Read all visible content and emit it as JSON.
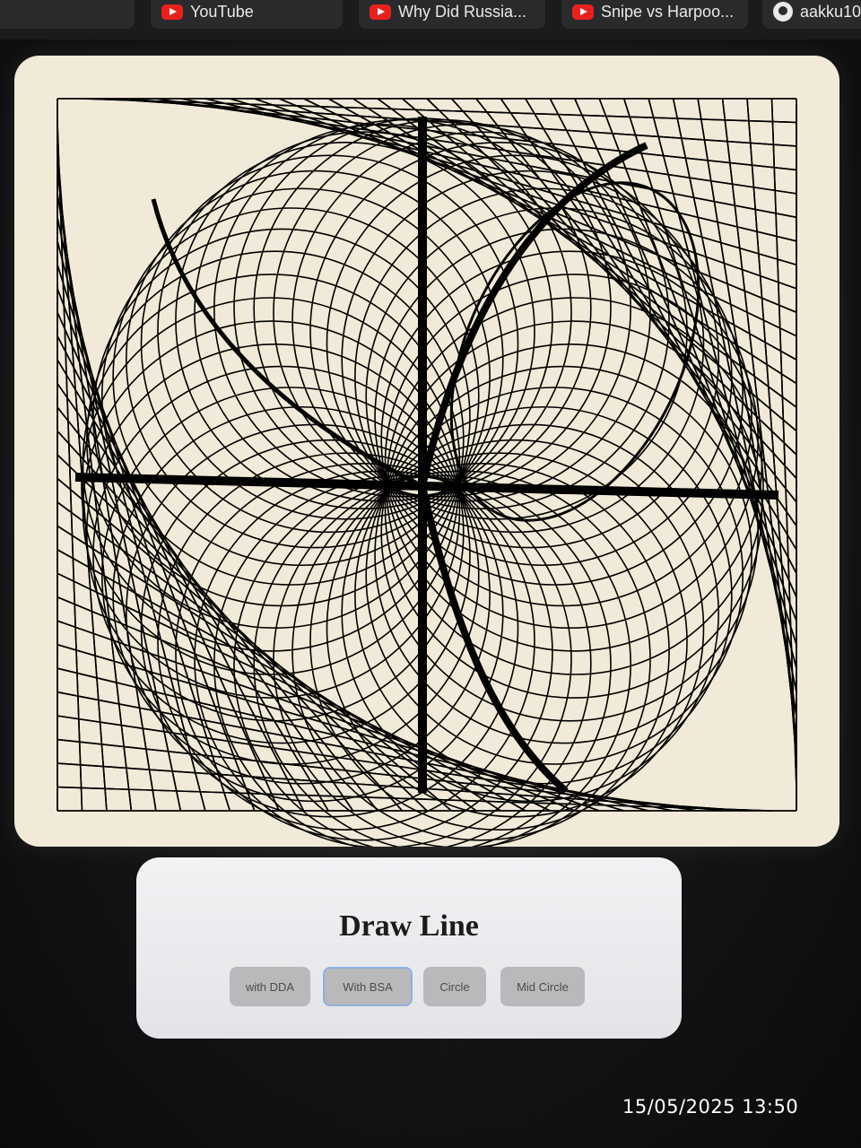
{
  "bookmarks": [
    {
      "label": "",
      "icon": "blank"
    },
    {
      "label": "YouTube",
      "icon": "youtube-icon"
    },
    {
      "label": "Why Did Russia...",
      "icon": "youtube-icon"
    },
    {
      "label": "Snipe vs Harpoo...",
      "icon": "youtube-icon"
    },
    {
      "label": "aakku10",
      "icon": "github-icon"
    }
  ],
  "panel": {
    "title": "Draw Line",
    "buttons": [
      {
        "label": "with DDA"
      },
      {
        "label": "With BSA",
        "active": true
      },
      {
        "label": "Circle"
      },
      {
        "label": "Mid Circle"
      }
    ]
  },
  "timestamp": "15/05/2025  13:50",
  "colors": {
    "canvas_bg": "#f1ead8",
    "ink": "#000000",
    "panel_bg": "#e9eaec",
    "button_bg": "#b9b9bb",
    "active_outline": "#8fb1e0"
  }
}
